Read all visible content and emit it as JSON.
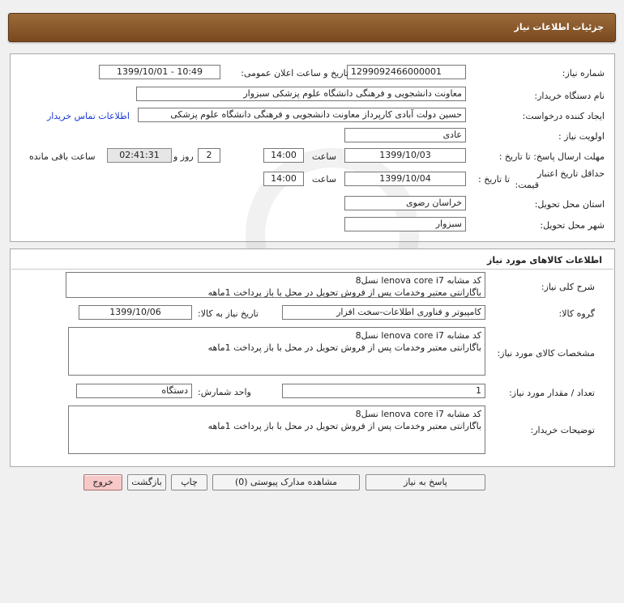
{
  "header": {
    "title": "جزئیات اطلاعات نیاز"
  },
  "info": {
    "need_number_label": "شماره نیاز:",
    "need_number": "1299092466000001",
    "announce_label": "تاریخ و ساعت اعلان عمومی:",
    "announce_value": "1399/10/01 - 10:49",
    "buyer_org_label": "نام دستگاه خریدار:",
    "buyer_org": "معاونت دانشجویی و فرهنگی دانشگاه علوم پزشکی سبزوار",
    "requester_label": "ایجاد کننده درخواست:",
    "requester": "حسین دولت آبادی کارپرداز معاونت دانشجویی و فرهنگی دانشگاه علوم پزشکی",
    "contact_link": "اطلاعات تماس خریدار",
    "priority_label": "اولویت نیاز :",
    "priority": "عادی",
    "deadline_label": "مهلت ارسال پاسخ: تا تاریخ :",
    "deadline_date": "1399/10/03",
    "hour_label": "ساعت",
    "deadline_time": "14:00",
    "days_value": "2",
    "days_label": "روز و",
    "remaining_time": "02:41:31",
    "remaining_label": "ساعت باقی مانده",
    "validity_label_1": "حداقل تاریخ اعتبار",
    "validity_label_2": "قیمت:",
    "validity_until_label": "تا تاریخ :",
    "validity_date": "1399/10/04",
    "validity_hour_label": "ساعت",
    "validity_time": "14:00",
    "province_label": "استان محل تحویل:",
    "province": "خراسان رضوی",
    "city_label": "شهر محل تحویل:",
    "city": "سبزوار"
  },
  "goods": {
    "section_title": "اطلاعات کالاهای مورد نیاز",
    "summary_label": "شرح کلی نیاز:",
    "summary_line1": "کد مشابه lenova core i7  نسل8",
    "summary_line2": "باگارانتی معتبر وخدمات پس از فروش تحویل در محل با باز پرداخت 1ماهه",
    "group_label": "گروه کالا:",
    "group_value": "کامپیوتر و فناوری اطلاعات-سخت افزار",
    "need_date_label": "تاریخ نیاز به کالا:",
    "need_date": "1399/10/06",
    "spec_label": "مشخصات کالای مورد نیاز:",
    "spec_line1": "کد مشابه lenova core i7  نسل8",
    "spec_line2": "باگارانتی معتبر وخدمات پس از فروش تحویل در محل با باز پرداخت 1ماهه",
    "qty_label": "تعداد / مقدار مورد نیاز:",
    "qty_value": "1",
    "unit_label": "واحد شمارش:",
    "unit_value": "دستگاه",
    "buyer_notes_label": "توضیحات خریدار:",
    "notes_line1": "کد مشابه lenova core i7  نسل8",
    "notes_line2": "باگارانتی معتبر وخدمات پس از فروش تحویل در محل با باز پرداخت 1ماهه"
  },
  "buttons": {
    "reply": "پاسخ به نیاز",
    "attachments": "مشاهده مدارک پیوستی (0)",
    "print": "چاپ",
    "back": "بازگشت",
    "exit": "خروج"
  }
}
